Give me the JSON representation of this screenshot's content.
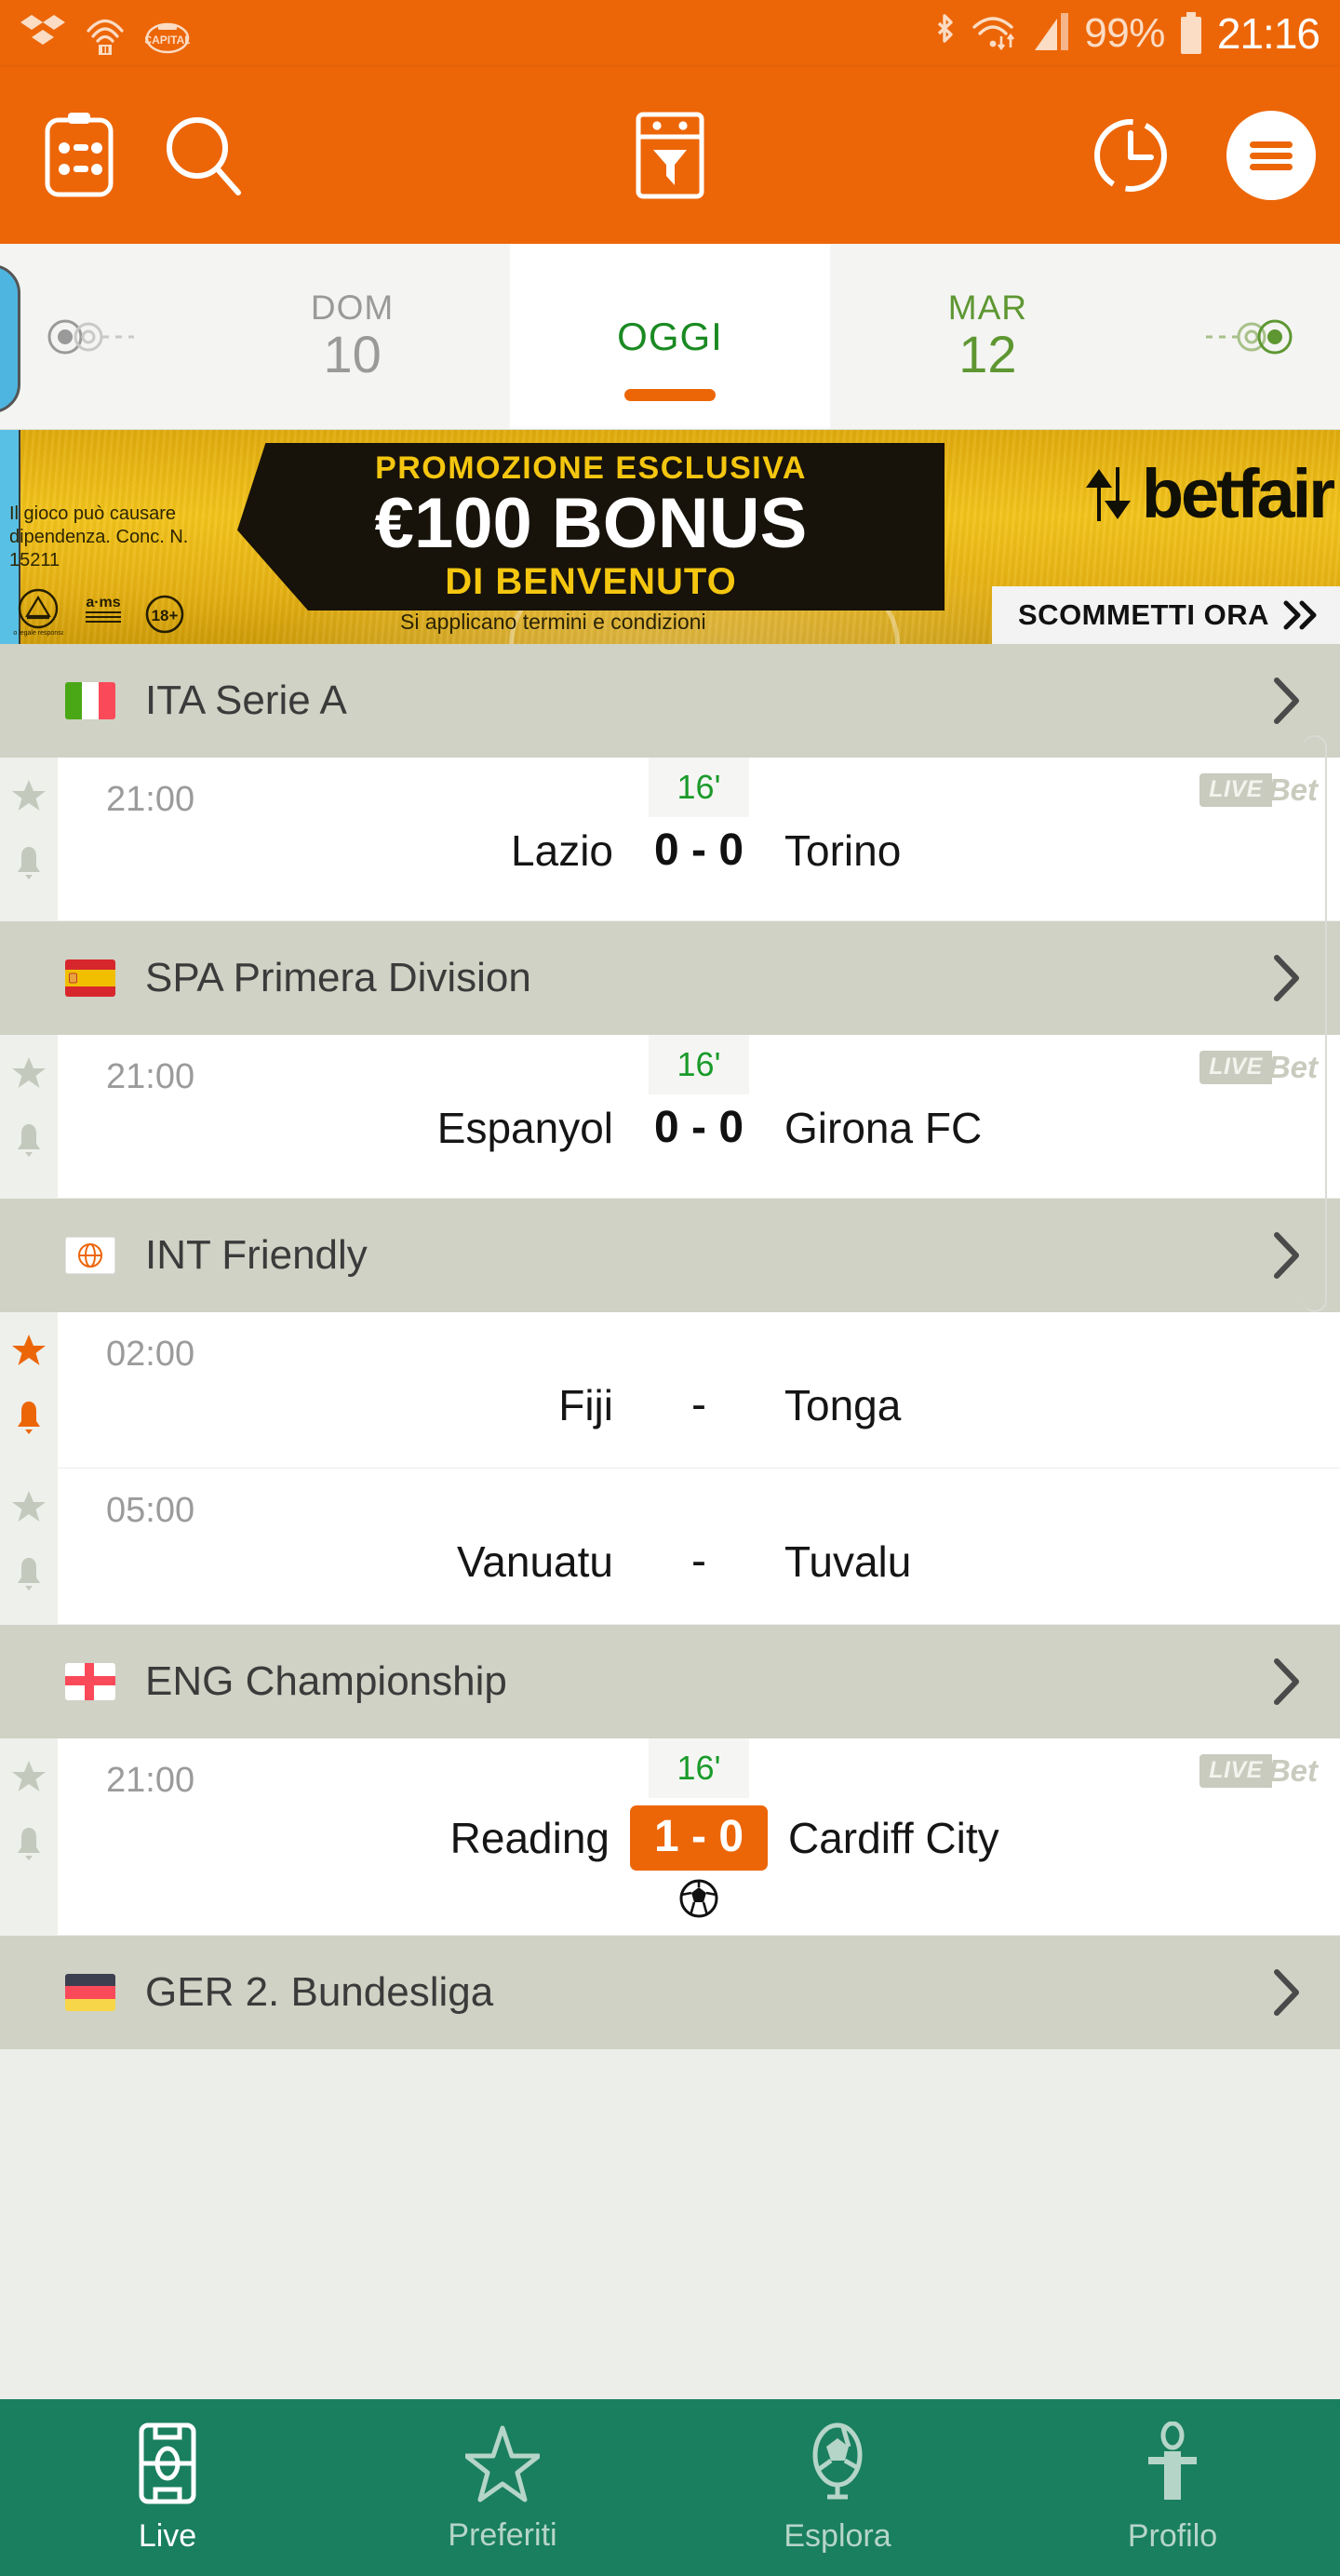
{
  "status_bar": {
    "left_icons": [
      "dropbox-icon",
      "audible-icon",
      "capital-radio-icon"
    ],
    "right_icons": [
      "bluetooth-icon",
      "wifi-icon",
      "signal-icon",
      "battery-icon"
    ],
    "battery": "99%",
    "clock": "21:16"
  },
  "toolbar": {
    "calendar_icon": "calendar-icon",
    "search_icon": "search-icon",
    "filter_icon": "filter-icon",
    "history_icon": "clock-history-icon",
    "menu_icon": "hamburger-menu-icon",
    "accent": "#ec6608"
  },
  "datebar": {
    "prev_arrow": "prev-days-icon",
    "next_arrow": "next-days-icon",
    "days": [
      {
        "dow": "DOM",
        "day": "10",
        "state": "past"
      },
      {
        "dow": "",
        "day": "",
        "today_label": "OGGI",
        "state": "today"
      },
      {
        "dow": "MAR",
        "day": "12",
        "state": "future"
      }
    ]
  },
  "banner": {
    "eyebrow": "PROMOZIONE ESCLUSIVA",
    "headline": "€100 BONUS",
    "subhead": "DI BENVENUTO",
    "terms": "Si applicano termini e condizioni",
    "legal": "Il gioco può causare dipendenza. Conc. N. 15211",
    "badge_adm": "gioco legale responsabile",
    "badge_ams": "adms",
    "badge_age": "18+",
    "brand": "betfair",
    "cta": "SCOMMETTI ORA",
    "cta_icon": "double-chevron-right-icon"
  },
  "leagues": [
    {
      "name": "ITA Serie A",
      "flag": "italy-flag",
      "flag_colors": [
        "#4aa816",
        "#ffffff",
        "#fa4a59"
      ],
      "matches": [
        {
          "time": "21:00",
          "minute": "16'",
          "home": "Lazio",
          "away": "Torino",
          "score": "0 - 0",
          "score_state": "live",
          "livebet": {
            "live": "LIVE",
            "bet": "Bet"
          },
          "starred": false,
          "notify": false,
          "event_icon": ""
        }
      ]
    },
    {
      "name": "SPA Primera Division",
      "flag": "spain-flag",
      "flag_colors": [
        "#d7272c",
        "#f1bf00",
        "#d7272c"
      ],
      "matches": [
        {
          "time": "21:00",
          "minute": "16'",
          "home": "Espanyol",
          "away": "Girona FC",
          "score": "0 - 0",
          "score_state": "live",
          "livebet": {
            "live": "LIVE",
            "bet": "Bet"
          },
          "starred": false,
          "notify": false,
          "event_icon": ""
        }
      ]
    },
    {
      "name": "INT Friendly",
      "flag": "globe-icon",
      "flag_colors": [],
      "matches": [
        {
          "time": "02:00",
          "minute": "",
          "home": "Fiji",
          "away": "Tonga",
          "score": "-",
          "score_state": "scheduled",
          "livebet": null,
          "starred": true,
          "notify": true,
          "event_icon": ""
        },
        {
          "time": "05:00",
          "minute": "",
          "home": "Vanuatu",
          "away": "Tuvalu",
          "score": "-",
          "score_state": "scheduled",
          "livebet": null,
          "starred": false,
          "notify": false,
          "event_icon": ""
        }
      ]
    },
    {
      "name": "ENG Championship",
      "flag": "england-flag",
      "flag_colors": [
        "#ffffff",
        "#fa4a59"
      ],
      "matches": [
        {
          "time": "21:00",
          "minute": "16'",
          "home": "Reading",
          "away": "Cardiff City",
          "score": "1 - 0",
          "score_state": "goal",
          "livebet": {
            "live": "LIVE",
            "bet": "Bet"
          },
          "starred": false,
          "notify": false,
          "event_icon": "football-icon"
        }
      ]
    },
    {
      "name": "GER 2. Bundesliga",
      "flag": "germany-flag",
      "flag_colors": [
        "#3c3f50",
        "#fa4a59",
        "#f7d64a"
      ],
      "matches": []
    }
  ],
  "bottom_nav": {
    "items": [
      {
        "label": "Live",
        "icon": "pitch-icon",
        "active": true
      },
      {
        "label": "Preferiti",
        "icon": "star-icon",
        "active": false
      },
      {
        "label": "Esplora",
        "icon": "explore-ball-icon",
        "active": false
      },
      {
        "label": "Profilo",
        "icon": "person-icon",
        "active": false
      }
    ]
  },
  "colors": {
    "accent_orange": "#ec6608",
    "nav_green": "#1a7f5f",
    "live_green": "#1a9a2a",
    "league_header": "#cfd2c4"
  }
}
